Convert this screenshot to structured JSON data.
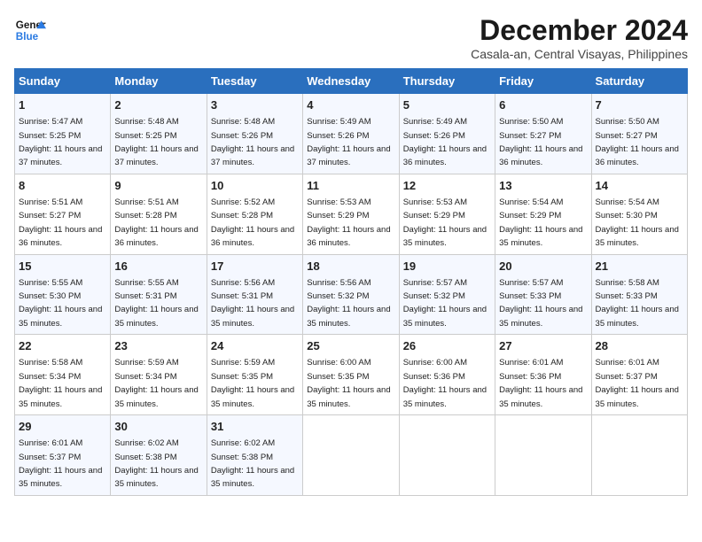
{
  "logo": {
    "line1": "General",
    "line2": "Blue"
  },
  "title": "December 2024",
  "location": "Casala-an, Central Visayas, Philippines",
  "weekdays": [
    "Sunday",
    "Monday",
    "Tuesday",
    "Wednesday",
    "Thursday",
    "Friday",
    "Saturday"
  ],
  "weeks": [
    [
      {
        "day": 1,
        "sunrise": "5:47 AM",
        "sunset": "5:25 PM",
        "daylight": "11 hours and 37 minutes."
      },
      {
        "day": 2,
        "sunrise": "5:48 AM",
        "sunset": "5:25 PM",
        "daylight": "11 hours and 37 minutes."
      },
      {
        "day": 3,
        "sunrise": "5:48 AM",
        "sunset": "5:26 PM",
        "daylight": "11 hours and 37 minutes."
      },
      {
        "day": 4,
        "sunrise": "5:49 AM",
        "sunset": "5:26 PM",
        "daylight": "11 hours and 37 minutes."
      },
      {
        "day": 5,
        "sunrise": "5:49 AM",
        "sunset": "5:26 PM",
        "daylight": "11 hours and 36 minutes."
      },
      {
        "day": 6,
        "sunrise": "5:50 AM",
        "sunset": "5:27 PM",
        "daylight": "11 hours and 36 minutes."
      },
      {
        "day": 7,
        "sunrise": "5:50 AM",
        "sunset": "5:27 PM",
        "daylight": "11 hours and 36 minutes."
      }
    ],
    [
      {
        "day": 8,
        "sunrise": "5:51 AM",
        "sunset": "5:27 PM",
        "daylight": "11 hours and 36 minutes."
      },
      {
        "day": 9,
        "sunrise": "5:51 AM",
        "sunset": "5:28 PM",
        "daylight": "11 hours and 36 minutes."
      },
      {
        "day": 10,
        "sunrise": "5:52 AM",
        "sunset": "5:28 PM",
        "daylight": "11 hours and 36 minutes."
      },
      {
        "day": 11,
        "sunrise": "5:53 AM",
        "sunset": "5:29 PM",
        "daylight": "11 hours and 36 minutes."
      },
      {
        "day": 12,
        "sunrise": "5:53 AM",
        "sunset": "5:29 PM",
        "daylight": "11 hours and 35 minutes."
      },
      {
        "day": 13,
        "sunrise": "5:54 AM",
        "sunset": "5:29 PM",
        "daylight": "11 hours and 35 minutes."
      },
      {
        "day": 14,
        "sunrise": "5:54 AM",
        "sunset": "5:30 PM",
        "daylight": "11 hours and 35 minutes."
      }
    ],
    [
      {
        "day": 15,
        "sunrise": "5:55 AM",
        "sunset": "5:30 PM",
        "daylight": "11 hours and 35 minutes."
      },
      {
        "day": 16,
        "sunrise": "5:55 AM",
        "sunset": "5:31 PM",
        "daylight": "11 hours and 35 minutes."
      },
      {
        "day": 17,
        "sunrise": "5:56 AM",
        "sunset": "5:31 PM",
        "daylight": "11 hours and 35 minutes."
      },
      {
        "day": 18,
        "sunrise": "5:56 AM",
        "sunset": "5:32 PM",
        "daylight": "11 hours and 35 minutes."
      },
      {
        "day": 19,
        "sunrise": "5:57 AM",
        "sunset": "5:32 PM",
        "daylight": "11 hours and 35 minutes."
      },
      {
        "day": 20,
        "sunrise": "5:57 AM",
        "sunset": "5:33 PM",
        "daylight": "11 hours and 35 minutes."
      },
      {
        "day": 21,
        "sunrise": "5:58 AM",
        "sunset": "5:33 PM",
        "daylight": "11 hours and 35 minutes."
      }
    ],
    [
      {
        "day": 22,
        "sunrise": "5:58 AM",
        "sunset": "5:34 PM",
        "daylight": "11 hours and 35 minutes."
      },
      {
        "day": 23,
        "sunrise": "5:59 AM",
        "sunset": "5:34 PM",
        "daylight": "11 hours and 35 minutes."
      },
      {
        "day": 24,
        "sunrise": "5:59 AM",
        "sunset": "5:35 PM",
        "daylight": "11 hours and 35 minutes."
      },
      {
        "day": 25,
        "sunrise": "6:00 AM",
        "sunset": "5:35 PM",
        "daylight": "11 hours and 35 minutes."
      },
      {
        "day": 26,
        "sunrise": "6:00 AM",
        "sunset": "5:36 PM",
        "daylight": "11 hours and 35 minutes."
      },
      {
        "day": 27,
        "sunrise": "6:01 AM",
        "sunset": "5:36 PM",
        "daylight": "11 hours and 35 minutes."
      },
      {
        "day": 28,
        "sunrise": "6:01 AM",
        "sunset": "5:37 PM",
        "daylight": "11 hours and 35 minutes."
      }
    ],
    [
      {
        "day": 29,
        "sunrise": "6:01 AM",
        "sunset": "5:37 PM",
        "daylight": "11 hours and 35 minutes."
      },
      {
        "day": 30,
        "sunrise": "6:02 AM",
        "sunset": "5:38 PM",
        "daylight": "11 hours and 35 minutes."
      },
      {
        "day": 31,
        "sunrise": "6:02 AM",
        "sunset": "5:38 PM",
        "daylight": "11 hours and 35 minutes."
      },
      null,
      null,
      null,
      null
    ]
  ]
}
